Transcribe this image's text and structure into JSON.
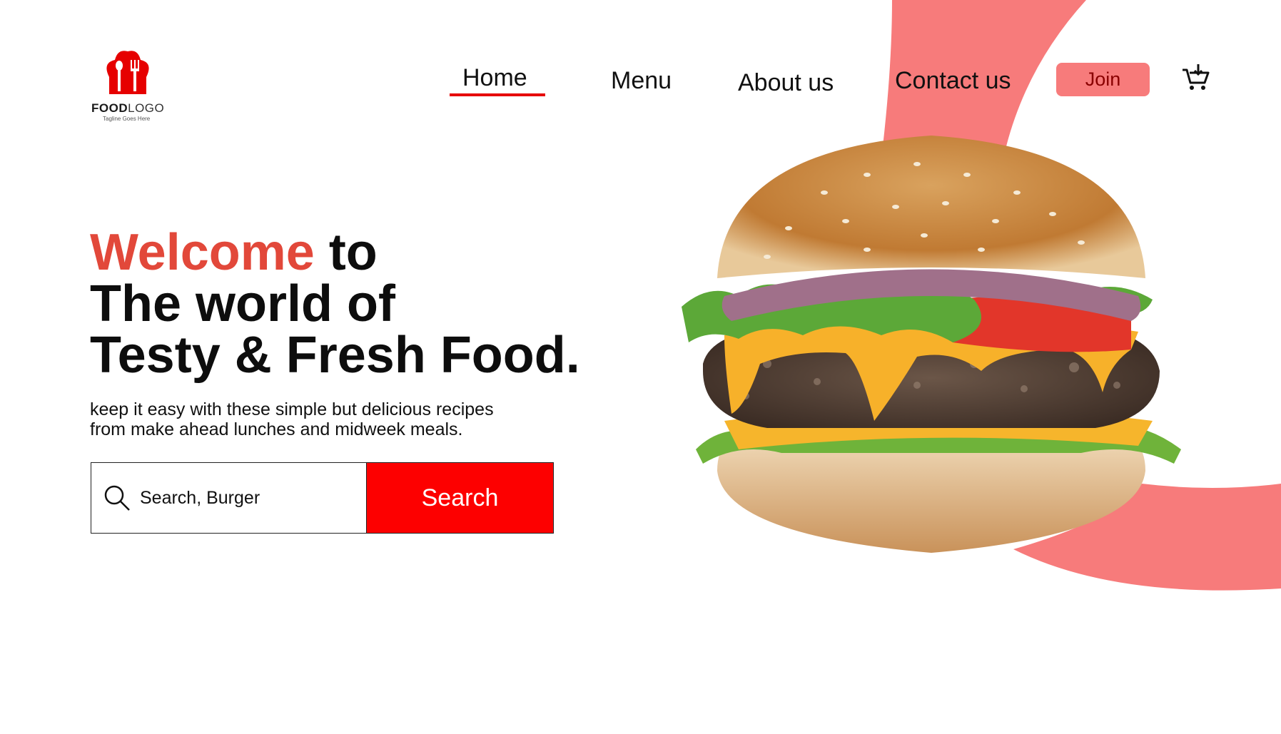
{
  "colors": {
    "accent": "#e2483a",
    "brand_red": "#fd0000",
    "swoosh_pink": "#f77b7b",
    "nav_underline": "#e60000"
  },
  "logo": {
    "brand_bold": "FOOD",
    "brand_light": "LOGO",
    "tagline": "Tagline Goes Here",
    "icon": "chef-hat-icon"
  },
  "nav": {
    "items": [
      {
        "label": "Home",
        "active": true
      },
      {
        "label": "Menu",
        "active": false
      },
      {
        "label": "About us",
        "active": false
      },
      {
        "label": "Contact us",
        "active": false
      }
    ],
    "join_label": "Join",
    "cart_icon": "cart-icon"
  },
  "hero": {
    "headline_accent": "Welcome",
    "headline_rest_line1": "to",
    "headline_line2": "The world of",
    "headline_line3": "Testy & Fresh Food.",
    "subtext_line1": "keep it easy with these simple but delicious recipes",
    "subtext_line2": "from make ahead lunches and midweek meals."
  },
  "search": {
    "placeholder": "Search, Burger",
    "value": "",
    "button_label": "Search",
    "icon": "search-icon"
  },
  "image": {
    "subject": "burger-image"
  }
}
